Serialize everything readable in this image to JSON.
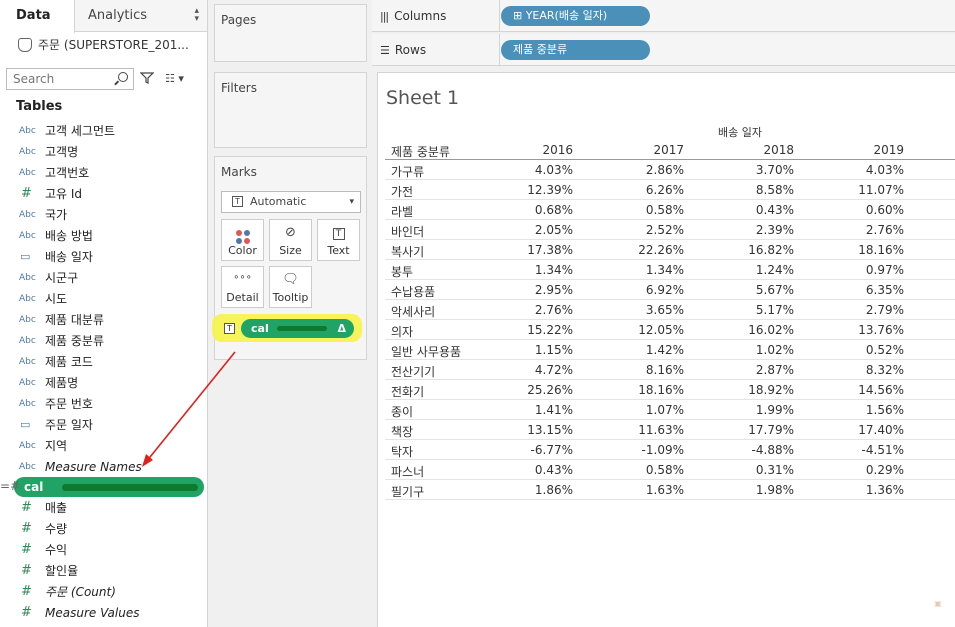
{
  "data_pane": {
    "tab_data": "Data",
    "tab_analytics": "Analytics",
    "datasource": "주문 (SUPERSTORE_201...",
    "search_placeholder": "Search",
    "tables_title": "Tables",
    "fields": [
      {
        "type": "Abc",
        "name": "고객 세그먼트"
      },
      {
        "type": "Abc",
        "name": "고객명"
      },
      {
        "type": "Abc",
        "name": "고객번호"
      },
      {
        "type": "#",
        "name": "고유 Id"
      },
      {
        "type": "Abc",
        "name": "국가"
      },
      {
        "type": "Abc",
        "name": "배송 방법"
      },
      {
        "type": "date",
        "name": "배송 일자"
      },
      {
        "type": "Abc",
        "name": "시군구"
      },
      {
        "type": "Abc",
        "name": "시도"
      },
      {
        "type": "Abc",
        "name": "제품 대분류"
      },
      {
        "type": "Abc",
        "name": "제품 중분류"
      },
      {
        "type": "Abc",
        "name": "제품 코드"
      },
      {
        "type": "Abc",
        "name": "제품명"
      },
      {
        "type": "Abc",
        "name": "주문 번호"
      },
      {
        "type": "date",
        "name": "주문 일자"
      },
      {
        "type": "Abc",
        "name": "지역"
      },
      {
        "type": "Abc",
        "name": "Measure Names",
        "italic": true
      },
      {
        "type": "=#",
        "name": "cal",
        "highlight": true
      },
      {
        "type": "#",
        "name": "매출"
      },
      {
        "type": "#",
        "name": "수량"
      },
      {
        "type": "#",
        "name": "수익"
      },
      {
        "type": "#",
        "name": "할인율"
      },
      {
        "type": "#",
        "name": "주문 (Count)",
        "italic": true
      },
      {
        "type": "#",
        "name": "Measure Values",
        "italic": true
      }
    ]
  },
  "cards": {
    "pages": "Pages",
    "filters": "Filters",
    "marks": "Marks",
    "mark_type": "Automatic",
    "buttons": {
      "color": "Color",
      "size": "Size",
      "text": "Text",
      "detail": "Detail",
      "tooltip": "Tooltip"
    },
    "text_pill": "cal",
    "text_pill_delta": "Δ"
  },
  "shelves": {
    "columns_label": "Columns",
    "columns_pill": "⊞ YEAR(배송 일자)",
    "rows_label": "Rows",
    "rows_pill": "제품 중분류"
  },
  "sheet": {
    "title": "Sheet 1",
    "column_header_title": "배송 일자",
    "row_header": "제품 중분류",
    "years": [
      "2016",
      "2017",
      "2018",
      "2019"
    ],
    "rows": [
      {
        "name": "가구류",
        "values": [
          "4.03%",
          "2.86%",
          "3.70%",
          "4.03%"
        ]
      },
      {
        "name": "가전",
        "values": [
          "12.39%",
          "6.26%",
          "8.58%",
          "11.07%"
        ]
      },
      {
        "name": "라벨",
        "values": [
          "0.68%",
          "0.58%",
          "0.43%",
          "0.60%"
        ]
      },
      {
        "name": "바인더",
        "values": [
          "2.05%",
          "2.52%",
          "2.39%",
          "2.76%"
        ]
      },
      {
        "name": "복사기",
        "values": [
          "17.38%",
          "22.26%",
          "16.82%",
          "18.16%"
        ]
      },
      {
        "name": "봉투",
        "values": [
          "1.34%",
          "1.34%",
          "1.24%",
          "0.97%"
        ]
      },
      {
        "name": "수납용품",
        "values": [
          "2.95%",
          "6.92%",
          "5.67%",
          "6.35%"
        ]
      },
      {
        "name": "악세사리",
        "values": [
          "2.76%",
          "3.65%",
          "5.17%",
          "2.79%"
        ]
      },
      {
        "name": "의자",
        "values": [
          "15.22%",
          "12.05%",
          "16.02%",
          "13.76%"
        ]
      },
      {
        "name": "일반 사무용품",
        "values": [
          "1.15%",
          "1.42%",
          "1.02%",
          "0.52%"
        ]
      },
      {
        "name": "전산기기",
        "values": [
          "4.72%",
          "8.16%",
          "2.87%",
          "8.32%"
        ]
      },
      {
        "name": "전화기",
        "values": [
          "25.26%",
          "18.16%",
          "18.92%",
          "14.56%"
        ]
      },
      {
        "name": "종이",
        "values": [
          "1.41%",
          "1.07%",
          "1.99%",
          "1.56%"
        ]
      },
      {
        "name": "책장",
        "values": [
          "13.15%",
          "11.63%",
          "17.79%",
          "17.40%"
        ]
      },
      {
        "name": "탁자",
        "values": [
          "-6.77%",
          "-1.09%",
          "-4.88%",
          "-4.51%"
        ]
      },
      {
        "name": "파스너",
        "values": [
          "0.43%",
          "0.58%",
          "0.31%",
          "0.29%"
        ]
      },
      {
        "name": "필기구",
        "values": [
          "1.86%",
          "1.63%",
          "1.98%",
          "1.36%"
        ]
      }
    ]
  },
  "colors": {
    "pill_blue": "#4a90b8",
    "highlight_green": "#21a366",
    "highlight_yellow": "#f7f34a",
    "annotation_red": "#e0201b"
  }
}
